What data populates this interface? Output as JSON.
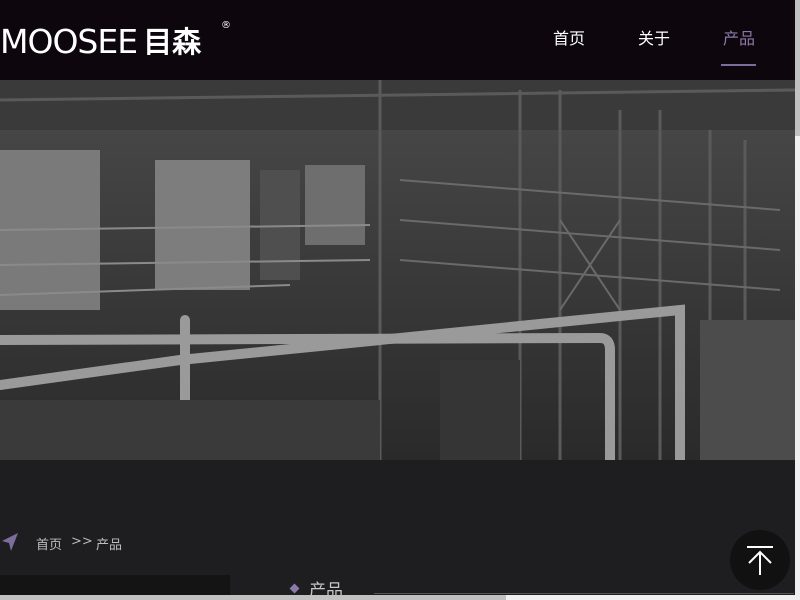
{
  "header": {
    "logo": {
      "latin": "MOOSEE",
      "chinese": "目森",
      "registered": "®"
    },
    "nav": [
      {
        "label": "首页",
        "active": false
      },
      {
        "label": "关于",
        "active": false
      },
      {
        "label": "产品",
        "active": true
      }
    ],
    "accent_color": "#7d6d9c"
  },
  "banner": {
    "image": "industrial-factory-photo"
  },
  "breadcrumb": {
    "icon": "location-arrow-icon",
    "home": "首页",
    "separator": ">>",
    "current": "产品"
  },
  "section": {
    "title": "产品"
  },
  "back_to_top": {
    "icon": "arrow-up-icon"
  }
}
